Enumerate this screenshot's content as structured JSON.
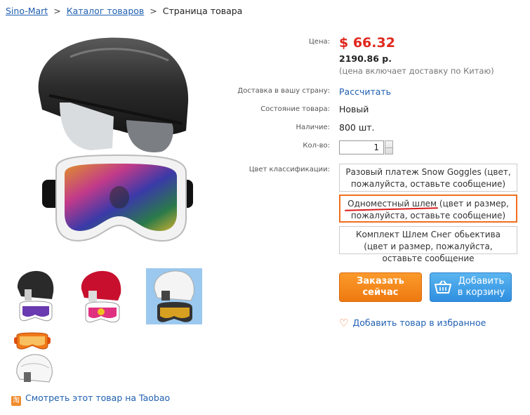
{
  "breadcrumb": {
    "home": "Sino-Mart",
    "catalog": "Каталог товаров",
    "current": "Страница товара",
    "separator": ">"
  },
  "product": {
    "price_label": "Цена:",
    "price": "$ 66.32",
    "price_rub": "2190.86 р.",
    "price_note": "(цена включает доставку по Китаю)",
    "delivery_label": "Доставка в вашу страну:",
    "delivery_link": "Рассчитать",
    "condition_label": "Состояние товара:",
    "condition": "Новый",
    "stock_label": "Наличие:",
    "stock": "800 шт.",
    "qty_label": "Кол-во:",
    "qty": "1",
    "color_label": "Цвет классификации:",
    "options": [
      {
        "text": "Разовый платеж Snow Goggles (цвет, пожалуйста, оставьте сообщение)"
      },
      {
        "first": "Одноместный шлем",
        "rest": " (цвет и размер, пожалуйста, оставьте сообщение)"
      },
      {
        "text": "Комплект Шлем Снег обьектива (цвет и размер, пожалуйста, оставьте сообщение"
      }
    ]
  },
  "actions": {
    "buy_now": "Заказать сейчас",
    "add_to_cart": "Добавить в корзину",
    "favorite": "Добавить товар в избранное",
    "taobao_icon": "淘",
    "taobao": "Смотреть этот товар на Taobao"
  },
  "colors": {
    "price": "#e0281e",
    "link": "#1f5fb0",
    "buy": "#f28a1c",
    "cart": "#3b9be6",
    "selected_border": "#f06f1e"
  }
}
